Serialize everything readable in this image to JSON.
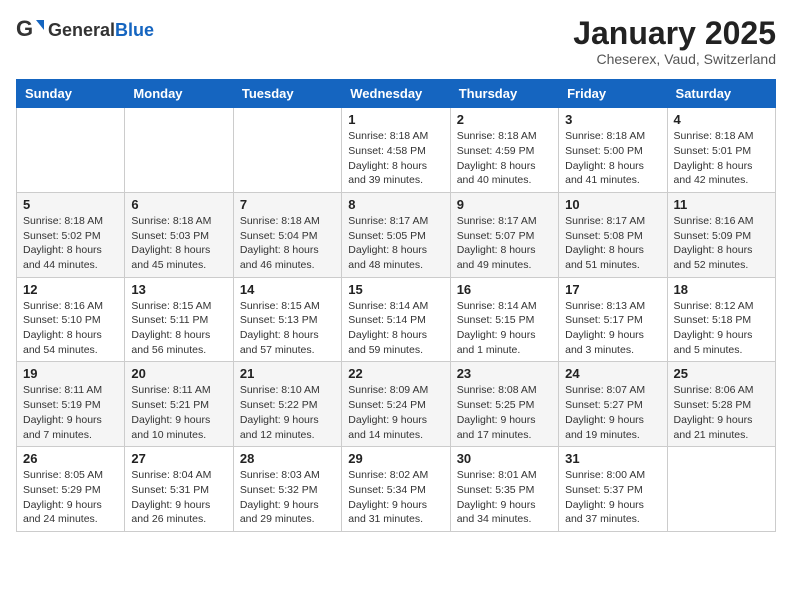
{
  "header": {
    "logo_general": "General",
    "logo_blue": "Blue",
    "month_title": "January 2025",
    "subtitle": "Cheserex, Vaud, Switzerland"
  },
  "days_of_week": [
    "Sunday",
    "Monday",
    "Tuesday",
    "Wednesday",
    "Thursday",
    "Friday",
    "Saturday"
  ],
  "weeks": [
    [
      {
        "day": "",
        "info": ""
      },
      {
        "day": "",
        "info": ""
      },
      {
        "day": "",
        "info": ""
      },
      {
        "day": "1",
        "info": "Sunrise: 8:18 AM\nSunset: 4:58 PM\nDaylight: 8 hours\nand 39 minutes."
      },
      {
        "day": "2",
        "info": "Sunrise: 8:18 AM\nSunset: 4:59 PM\nDaylight: 8 hours\nand 40 minutes."
      },
      {
        "day": "3",
        "info": "Sunrise: 8:18 AM\nSunset: 5:00 PM\nDaylight: 8 hours\nand 41 minutes."
      },
      {
        "day": "4",
        "info": "Sunrise: 8:18 AM\nSunset: 5:01 PM\nDaylight: 8 hours\nand 42 minutes."
      }
    ],
    [
      {
        "day": "5",
        "info": "Sunrise: 8:18 AM\nSunset: 5:02 PM\nDaylight: 8 hours\nand 44 minutes."
      },
      {
        "day": "6",
        "info": "Sunrise: 8:18 AM\nSunset: 5:03 PM\nDaylight: 8 hours\nand 45 minutes."
      },
      {
        "day": "7",
        "info": "Sunrise: 8:18 AM\nSunset: 5:04 PM\nDaylight: 8 hours\nand 46 minutes."
      },
      {
        "day": "8",
        "info": "Sunrise: 8:17 AM\nSunset: 5:05 PM\nDaylight: 8 hours\nand 48 minutes."
      },
      {
        "day": "9",
        "info": "Sunrise: 8:17 AM\nSunset: 5:07 PM\nDaylight: 8 hours\nand 49 minutes."
      },
      {
        "day": "10",
        "info": "Sunrise: 8:17 AM\nSunset: 5:08 PM\nDaylight: 8 hours\nand 51 minutes."
      },
      {
        "day": "11",
        "info": "Sunrise: 8:16 AM\nSunset: 5:09 PM\nDaylight: 8 hours\nand 52 minutes."
      }
    ],
    [
      {
        "day": "12",
        "info": "Sunrise: 8:16 AM\nSunset: 5:10 PM\nDaylight: 8 hours\nand 54 minutes."
      },
      {
        "day": "13",
        "info": "Sunrise: 8:15 AM\nSunset: 5:11 PM\nDaylight: 8 hours\nand 56 minutes."
      },
      {
        "day": "14",
        "info": "Sunrise: 8:15 AM\nSunset: 5:13 PM\nDaylight: 8 hours\nand 57 minutes."
      },
      {
        "day": "15",
        "info": "Sunrise: 8:14 AM\nSunset: 5:14 PM\nDaylight: 8 hours\nand 59 minutes."
      },
      {
        "day": "16",
        "info": "Sunrise: 8:14 AM\nSunset: 5:15 PM\nDaylight: 9 hours\nand 1 minute."
      },
      {
        "day": "17",
        "info": "Sunrise: 8:13 AM\nSunset: 5:17 PM\nDaylight: 9 hours\nand 3 minutes."
      },
      {
        "day": "18",
        "info": "Sunrise: 8:12 AM\nSunset: 5:18 PM\nDaylight: 9 hours\nand 5 minutes."
      }
    ],
    [
      {
        "day": "19",
        "info": "Sunrise: 8:11 AM\nSunset: 5:19 PM\nDaylight: 9 hours\nand 7 minutes."
      },
      {
        "day": "20",
        "info": "Sunrise: 8:11 AM\nSunset: 5:21 PM\nDaylight: 9 hours\nand 10 minutes."
      },
      {
        "day": "21",
        "info": "Sunrise: 8:10 AM\nSunset: 5:22 PM\nDaylight: 9 hours\nand 12 minutes."
      },
      {
        "day": "22",
        "info": "Sunrise: 8:09 AM\nSunset: 5:24 PM\nDaylight: 9 hours\nand 14 minutes."
      },
      {
        "day": "23",
        "info": "Sunrise: 8:08 AM\nSunset: 5:25 PM\nDaylight: 9 hours\nand 17 minutes."
      },
      {
        "day": "24",
        "info": "Sunrise: 8:07 AM\nSunset: 5:27 PM\nDaylight: 9 hours\nand 19 minutes."
      },
      {
        "day": "25",
        "info": "Sunrise: 8:06 AM\nSunset: 5:28 PM\nDaylight: 9 hours\nand 21 minutes."
      }
    ],
    [
      {
        "day": "26",
        "info": "Sunrise: 8:05 AM\nSunset: 5:29 PM\nDaylight: 9 hours\nand 24 minutes."
      },
      {
        "day": "27",
        "info": "Sunrise: 8:04 AM\nSunset: 5:31 PM\nDaylight: 9 hours\nand 26 minutes."
      },
      {
        "day": "28",
        "info": "Sunrise: 8:03 AM\nSunset: 5:32 PM\nDaylight: 9 hours\nand 29 minutes."
      },
      {
        "day": "29",
        "info": "Sunrise: 8:02 AM\nSunset: 5:34 PM\nDaylight: 9 hours\nand 31 minutes."
      },
      {
        "day": "30",
        "info": "Sunrise: 8:01 AM\nSunset: 5:35 PM\nDaylight: 9 hours\nand 34 minutes."
      },
      {
        "day": "31",
        "info": "Sunrise: 8:00 AM\nSunset: 5:37 PM\nDaylight: 9 hours\nand 37 minutes."
      },
      {
        "day": "",
        "info": ""
      }
    ]
  ]
}
